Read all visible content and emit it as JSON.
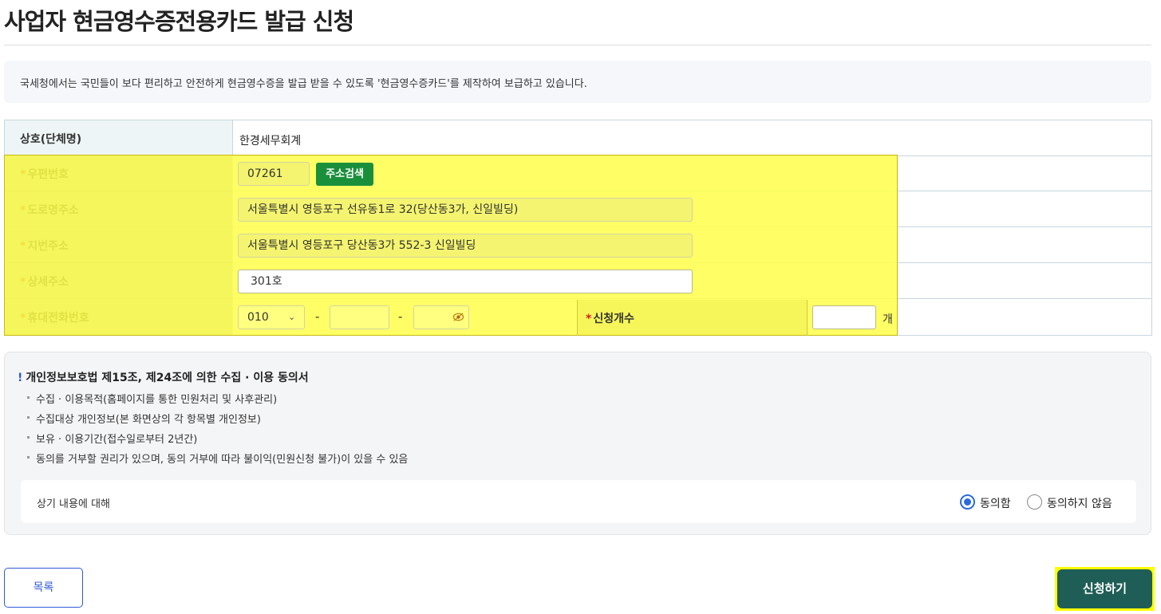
{
  "page": {
    "title": "사업자 현금영수증전용카드 발급 신청"
  },
  "notice": {
    "text": "국세청에서는 국민들이 보다 편리하고 안전하게 현금영수증을 발급 받을 수 있도록 '현금영수증카드'를 제작하여 보급하고 있습니다."
  },
  "form": {
    "company": {
      "label": "상호(단체명)",
      "value": "한경세무회계"
    },
    "postal": {
      "label": "우편번호",
      "value": "07261",
      "search_button": "주소검색"
    },
    "road_address": {
      "label": "도로명주소",
      "value": "서울특별시 영등포구 선유동1로 32(당산동3가, 신일빌딩)"
    },
    "lot_address": {
      "label": "지번주소",
      "value": "서울특별시 영등포구 당산동3가 552-3 신일빌딩"
    },
    "detail_address": {
      "label": "상세주소",
      "value": "301호"
    },
    "phone": {
      "label": "휴대전화번호",
      "prefix": "010",
      "middle": "",
      "last": "",
      "separator": "-"
    },
    "quantity": {
      "label": "신청개수",
      "value": "",
      "unit": "개"
    },
    "required_mark": "*"
  },
  "consent": {
    "title": "개인정보보호법 제15조, 제24조에 의한 수집 · 이용 동의서",
    "title_mark": "!",
    "items": [
      "수집 · 이용목적(홈페이지를 통한 민원처리 및 사후관리)",
      "수집대상 개인정보(본 화면상의 각 항목별 개인정보)",
      "보유 · 이용기간(접수일로부터 2년간)",
      "동의를 거부할 권리가 있으며, 동의  거부에 따라 불이익(민원신청 불가)이 있을 수 있음"
    ],
    "agree_prompt": "상기 내용에 대해",
    "options": [
      {
        "label": "동의함",
        "checked": true
      },
      {
        "label": "동의하지 않음",
        "checked": false
      }
    ]
  },
  "buttons": {
    "list": "목록",
    "submit": "신청하기"
  },
  "colors": {
    "accent": "#2f5bd6",
    "search_button": "#1a8f3b",
    "submit": "#1f5e56",
    "highlight": "#ffff50",
    "header_cell": "#eef5f6"
  }
}
